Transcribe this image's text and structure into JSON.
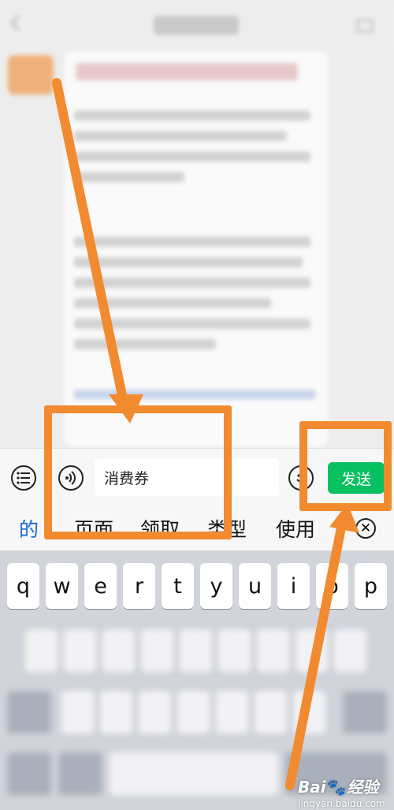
{
  "input": {
    "value": "消费券",
    "send_label": "发送"
  },
  "candidates": [
    "的",
    "页面",
    "领取",
    "类型",
    "使用"
  ],
  "keyboard": {
    "row1": [
      "q",
      "w",
      "e",
      "r",
      "t",
      "y",
      "u",
      "i",
      "o",
      "p"
    ]
  },
  "icons": {
    "list": "list-icon",
    "voice": "voice-icon",
    "emoji": "emoji-icon",
    "close": "close-circle-icon"
  },
  "colors": {
    "send_button": "#07c160",
    "highlight": "#f28a30",
    "candidate_selected": "#1a66d9"
  },
  "watermark": {
    "logo_left": "Bai",
    "logo_paw": "🐾",
    "logo_right": "经验",
    "url": "jingyan.baidu.com"
  }
}
